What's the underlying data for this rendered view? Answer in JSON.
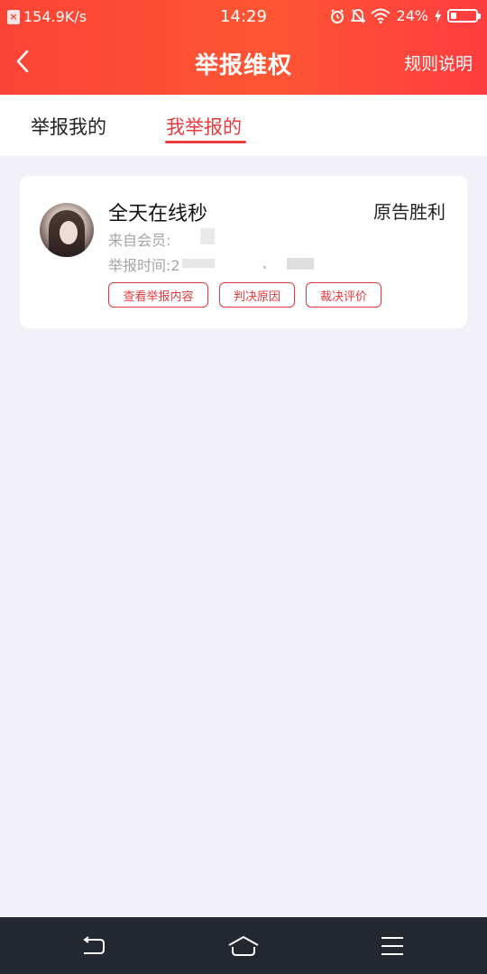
{
  "status_bar": {
    "speed": "154.9K/s",
    "time": "14:29",
    "battery": "24%",
    "icons": [
      "alarm-icon",
      "mute-icon",
      "wifi-icon",
      "charging-icon",
      "battery-icon"
    ]
  },
  "nav": {
    "title": "举报维权",
    "rule_link": "规则说明",
    "back_icon": "chevron-left-icon"
  },
  "tabs": [
    {
      "label": "举报我的",
      "active": false
    },
    {
      "label": "我举报的",
      "active": true
    }
  ],
  "card": {
    "name": "全天在线秒",
    "result": "原告胜利",
    "from_label": "来自会员:",
    "time_label": "举报时间:2",
    "buttons": [
      {
        "label": "查看举报内容"
      },
      {
        "label": "判决原因"
      },
      {
        "label": "裁决评价"
      }
    ]
  },
  "colors": {
    "header_start": "#fb4436",
    "header_end": "#ff3d3f",
    "accent": "#e93b3d",
    "background": "#f1f1f7",
    "system_nav": "#23272f"
  },
  "system_nav": {
    "icons": [
      "back-icon",
      "home-icon",
      "menu-icon"
    ]
  }
}
